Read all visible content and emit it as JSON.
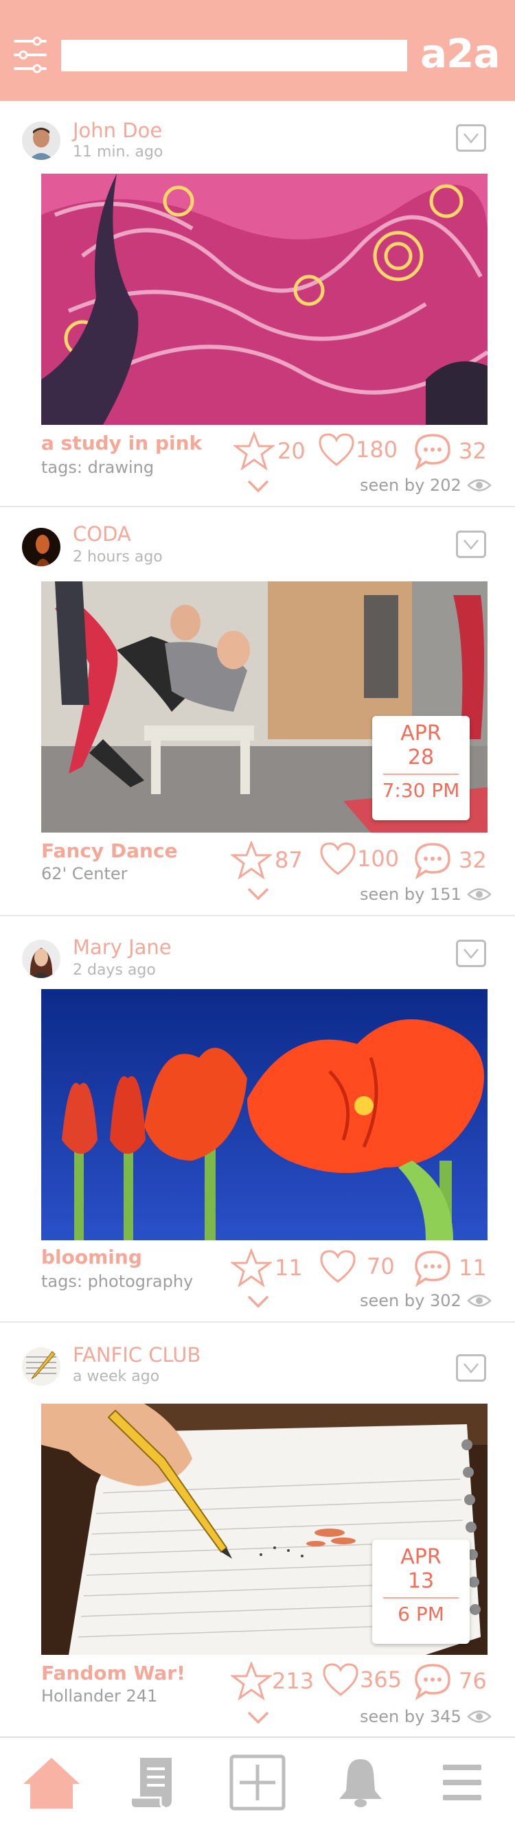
{
  "header": {
    "logo": "a2a",
    "search_placeholder": "",
    "search_value": "",
    "background": "#f9b3a4"
  },
  "accent_color": "#f4a898",
  "posts": [
    {
      "author": "John Doe",
      "time": "11 min. ago",
      "title": "a study in pink",
      "subtitle": "tags: drawing",
      "stars": "20",
      "likes": "180",
      "comments": "32",
      "seen": "seen by 202",
      "image": "swirling-night-painting-pink",
      "event": null
    },
    {
      "author": "CODA",
      "time": "2 hours ago",
      "title": "Fancy Dance",
      "subtitle": "62' Center",
      "stars": "87",
      "likes": "100",
      "comments": "32",
      "seen": "seen by 151",
      "image": "dancers-photo",
      "event": {
        "month": "APR",
        "day": "28",
        "time": "7:30 PM"
      }
    },
    {
      "author": "Mary Jane",
      "time": "2 days ago",
      "title": "blooming",
      "subtitle": "tags: photography",
      "stars": "11",
      "likes": "70",
      "comments": "11",
      "seen": "seen by 302",
      "image": "red-amaryllis-flowers",
      "event": null
    },
    {
      "author": "FANFIC CLUB",
      "time": "a week ago",
      "title": "Fandom War!",
      "subtitle": "Hollander 241",
      "stars": "213",
      "likes": "365",
      "comments": "76",
      "seen": "seen by 345",
      "image": "pencil-on-notebook",
      "event": {
        "month": "APR",
        "day": "13",
        "time": "6 PM"
      }
    }
  ],
  "bottom_nav": {
    "items": [
      "home-icon",
      "scroll-icon",
      "add-icon",
      "bell-icon",
      "menu-icon"
    ],
    "active": "home-icon"
  }
}
